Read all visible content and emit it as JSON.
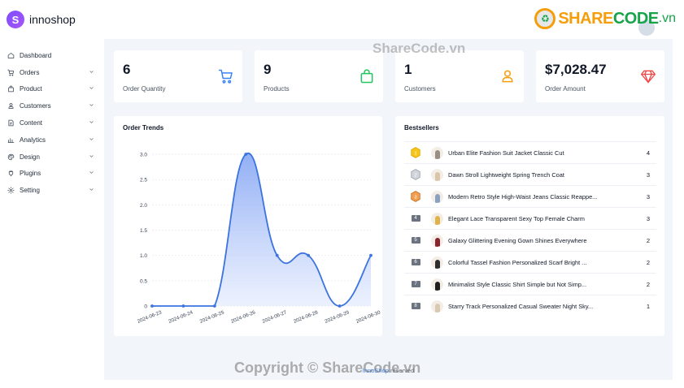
{
  "brand": {
    "name": "innoshop"
  },
  "watermark": {
    "share": "SHARE",
    "code": "CODE",
    "vn": ".vn",
    "center": "ShareCode.vn",
    "bottom": "Copyright © ShareCode.vn"
  },
  "sidebar": {
    "items": [
      {
        "label": "Dashboard",
        "icon": "home-icon",
        "chevron": false
      },
      {
        "label": "Orders",
        "icon": "cart-icon",
        "chevron": true
      },
      {
        "label": "Product",
        "icon": "bag-icon",
        "chevron": true
      },
      {
        "label": "Customers",
        "icon": "user-icon",
        "chevron": true
      },
      {
        "label": "Content",
        "icon": "document-icon",
        "chevron": true
      },
      {
        "label": "Analytics",
        "icon": "chart-icon",
        "chevron": true
      },
      {
        "label": "Design",
        "icon": "palette-icon",
        "chevron": true
      },
      {
        "label": "Plugins",
        "icon": "plugin-icon",
        "chevron": true
      },
      {
        "label": "Setting",
        "icon": "gear-icon",
        "chevron": true
      }
    ]
  },
  "stats": [
    {
      "value": "6",
      "label": "Order Quantity",
      "icon": "cart-icon",
      "color": "#3b82f6"
    },
    {
      "value": "9",
      "label": "Products",
      "icon": "bag-icon",
      "color": "#22c55e"
    },
    {
      "value": "1",
      "label": "Customers",
      "icon": "user-icon",
      "color": "#f59e0b"
    },
    {
      "value": "$7,028.47",
      "label": "Order Amount",
      "icon": "diamond-icon",
      "color": "#ef4444"
    }
  ],
  "order_trends": {
    "title": "Order Trends",
    "chart_data": {
      "type": "line",
      "x": [
        "2024-06-23",
        "2024-06-24",
        "2024-06-25",
        "2024-06-26",
        "2024-06-27",
        "2024-06-28",
        "2024-06-29",
        "2024-06-30"
      ],
      "series": [
        {
          "values": [
            0,
            0,
            0,
            3,
            1,
            1,
            0,
            1
          ]
        }
      ],
      "y_ticks": [
        "0",
        "0.5",
        "1.0",
        "1.5",
        "2.0",
        "2.5",
        "3.0"
      ],
      "ylim": [
        0,
        3
      ],
      "color": "#3b73e0",
      "grid": true
    }
  },
  "bestsellers": {
    "title": "Bestsellers",
    "items": [
      {
        "rank": "1",
        "name": "Urban Elite Fashion Suit Jacket Classic Cut",
        "qty": "4",
        "badge": "gold",
        "swatch": "#9a8f86"
      },
      {
        "rank": "2",
        "name": "Dawn Stroll Lightweight Spring Trench Coat",
        "qty": "3",
        "badge": "silver",
        "swatch": "#d9c6a8"
      },
      {
        "rank": "3",
        "name": "Modern Retro Style High-Waist Jeans Classic Reappe...",
        "qty": "3",
        "badge": "bronze",
        "swatch": "#8aa2c2"
      },
      {
        "rank": "4",
        "name": "Elegant Lace Transparent Sexy Top Female Charm",
        "qty": "3",
        "badge": "number",
        "swatch": "#e0b24a"
      },
      {
        "rank": "5",
        "name": "Galaxy Glittering Evening Gown Shines Everywhere",
        "qty": "2",
        "badge": "number",
        "swatch": "#8b2230"
      },
      {
        "rank": "6",
        "name": "Colorful Tassel Fashion Personalized Scarf Bright ...",
        "qty": "2",
        "badge": "number",
        "swatch": "#2d2d2d"
      },
      {
        "rank": "7",
        "name": "Minimalist Style Classic Shirt Simple but Not Simp...",
        "qty": "2",
        "badge": "number",
        "swatch": "#1f1f1f"
      },
      {
        "rank": "8",
        "name": "Starry Track Personalized Casual Sweater Night Sky...",
        "qty": "1",
        "badge": "number",
        "swatch": "#d8c9b0"
      }
    ]
  },
  "footer": {
    "link": "InnoShop",
    "text": "reserved"
  }
}
